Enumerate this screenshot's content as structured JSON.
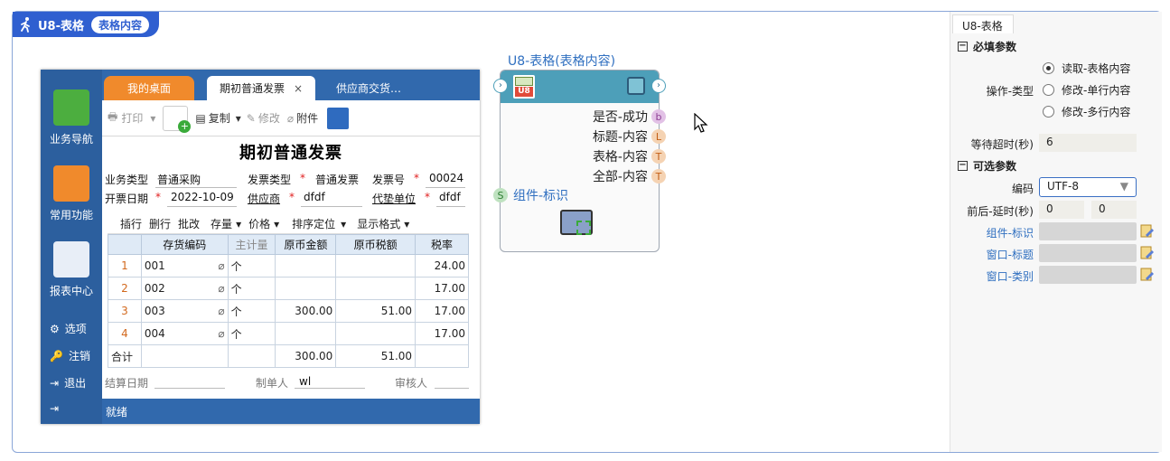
{
  "flow": {
    "title": "U8-表格",
    "pill": "表格内容"
  },
  "u8": {
    "side": {
      "nav": "业务导航",
      "fav": "常用功能",
      "report": "报表中心",
      "options": "选项",
      "logout": "注销",
      "exit": "退出"
    },
    "tabs": [
      "我的桌面",
      "期初普通发票",
      "供应商交货…"
    ],
    "toolbar": {
      "print": "打印",
      "copy": "复制",
      "modify": "修改",
      "attach": "附件"
    },
    "title": "期初普通发票",
    "form": {
      "biz_type_label": "业务类型",
      "biz_type_value": "普通采购",
      "inv_type_label": "发票类型",
      "inv_type_value": "普通发票",
      "inv_no_label": "发票号",
      "inv_no_value": "00024",
      "date_label": "开票日期",
      "date_value": "2022-10-09",
      "supplier_label": "供应商",
      "supplier_value": "dfdf",
      "agent_label": "代垫单位",
      "agent_value": "dfdf",
      "star": "*"
    },
    "gridbar": {
      "insert": "插行",
      "delete": "删行",
      "batch": "批改",
      "stock": "存量",
      "price": "价格",
      "sort": "排序定位",
      "display": "显示格式"
    },
    "grid": {
      "headers": [
        "",
        "存货编码",
        "主计量",
        "原币金额",
        "原币税额",
        "税率"
      ],
      "rows": [
        {
          "n": "1",
          "code": "001",
          "unit": "个",
          "amt": "",
          "tax": "",
          "rate": "24.00"
        },
        {
          "n": "2",
          "code": "002",
          "unit": "个",
          "amt": "",
          "tax": "",
          "rate": "17.00"
        },
        {
          "n": "3",
          "code": "003",
          "unit": "个",
          "amt": "300.00",
          "tax": "51.00",
          "rate": "17.00"
        },
        {
          "n": "4",
          "code": "004",
          "unit": "个",
          "amt": "",
          "tax": "",
          "rate": "17.00"
        }
      ],
      "total": {
        "label": "合计",
        "amt": "300.00",
        "tax": "51.00"
      }
    },
    "footer": {
      "settle_label": "结算日期",
      "maker_label": "制单人",
      "maker_value": "wl",
      "auditor_label": "审核人"
    },
    "status": "就绪"
  },
  "node": {
    "title": "U8-表格(表格内容)",
    "outputs": [
      {
        "label": "是否-成功",
        "port": "b",
        "color": "#c77bc8"
      },
      {
        "label": "标题-内容",
        "port": "L",
        "color": "#f09a3a"
      },
      {
        "label": "表格-内容",
        "port": "T",
        "color": "#f09a3a"
      },
      {
        "label": "全部-内容",
        "port": "T",
        "color": "#f09a3a"
      }
    ],
    "input": {
      "label": "组件-标识",
      "port": "S"
    }
  },
  "props": {
    "tab": "U8-表格",
    "required_title": "必填参数",
    "op_type_label": "操作-类型",
    "op_options": [
      "读取-表格内容",
      "修改-单行内容",
      "修改-多行内容"
    ],
    "op_selected": 0,
    "timeout_label": "等待超时(秒)",
    "timeout_value": "6",
    "optional_title": "可选参数",
    "encoding_label": "编码",
    "encoding_value": "UTF-8",
    "delay_label": "前后-延时(秒)",
    "delay_before": "0",
    "delay_after": "0",
    "component_label": "组件-标识",
    "window_title_label": "窗口-标题",
    "window_class_label": "窗口-类别"
  }
}
